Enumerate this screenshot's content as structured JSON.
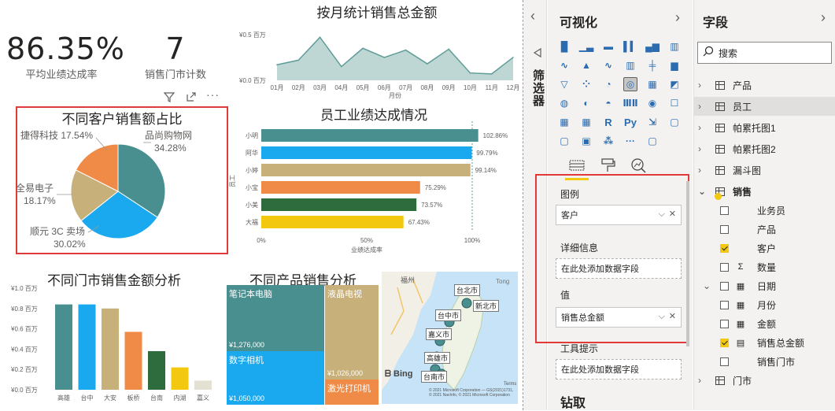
{
  "kpis": [
    {
      "value": "86.35%",
      "label": "平均业绩达成率"
    },
    {
      "value": "7",
      "label": "销售门市计数"
    }
  ],
  "charts": {
    "monthly": {
      "title": "按月统计销售总金额",
      "xlabel": "月份"
    },
    "pie": {
      "title": "不同客户销售额占比"
    },
    "staff": {
      "title": "员工业绩达成情况",
      "ylabel": "员工",
      "xlabel": "业绩达成率"
    },
    "store": {
      "title": "不同门市销售金额分析"
    },
    "product": {
      "title": "不同产品销售分析"
    }
  },
  "chart_data": [
    {
      "type": "area",
      "title": "按月统计销售总金额",
      "xlabel": "月份",
      "categories": [
        "01月",
        "02月",
        "03月",
        "04月",
        "05月",
        "06月",
        "07月",
        "08月",
        "09月",
        "10月",
        "11月",
        "12月"
      ],
      "values": [
        0.17,
        0.22,
        0.47,
        0.15,
        0.35,
        0.25,
        0.33,
        0.18,
        0.34,
        0.08,
        0.07,
        0.25
      ],
      "yticks": [
        "¥0.0 百万",
        "¥0.5 百万"
      ],
      "ylim": [
        0,
        0.55
      ],
      "color": "#a8c8c5"
    },
    {
      "type": "pie",
      "title": "不同客户销售额占比",
      "slices": [
        {
          "label": "品尚购物网",
          "pct": "34.28%",
          "value": 34.28,
          "color": "#4a8f8f"
        },
        {
          "label": "顺元 3C 卖场",
          "pct": "30.02%",
          "value": 30.02,
          "color": "#1aa9ef"
        },
        {
          "label": "全易电子",
          "pct": "18.17%",
          "value": 18.17,
          "color": "#c8b07a"
        },
        {
          "label": "捷得科技",
          "pct": "17.54%",
          "value": 17.54,
          "color": "#ef8b47"
        }
      ]
    },
    {
      "type": "bar",
      "orientation": "horizontal",
      "title": "员工业绩达成情况",
      "ylabel": "员工",
      "xlabel": "业绩达成率",
      "categories": [
        "小明",
        "阿华",
        "小婷",
        "小宝",
        "小美",
        "大福"
      ],
      "values": [
        102.86,
        99.79,
        99.14,
        75.29,
        73.57,
        67.43
      ],
      "labels": [
        "102.86%",
        "99.79%",
        "99.14%",
        "75.29%",
        "73.57%",
        "67.43%"
      ],
      "colors": [
        "#4a8f8f",
        "#1aa9ef",
        "#c8b07a",
        "#ef8b47",
        "#2e6b3d",
        "#f2c811"
      ],
      "xticks": [
        "0%",
        "50%",
        "100%"
      ],
      "xlim": [
        0,
        100
      ]
    },
    {
      "type": "bar",
      "title": "不同门市销售金额分析",
      "categories": [
        "高雄",
        "台中",
        "大安",
        "板桥",
        "台南",
        "内湖",
        "嘉义"
      ],
      "values": [
        0.84,
        0.84,
        0.8,
        0.57,
        0.38,
        0.22,
        0.09
      ],
      "colors": [
        "#4a8f8f",
        "#1aa9ef",
        "#c8b07a",
        "#ef8b47",
        "#2e6b3d",
        "#f2c811",
        "#e4e1d3"
      ],
      "yticks": [
        "¥0.0 百万",
        "¥0.2 百万",
        "¥0.4 百万",
        "¥0.6 百万",
        "¥0.8 百万",
        "¥1.0 百万"
      ],
      "ylim": [
        0,
        1.0
      ]
    },
    {
      "type": "treemap",
      "title": "不同产品销售分析",
      "items": [
        {
          "label": "笔记本电脑",
          "value": "¥1,276,000",
          "color": "#4a8f8f"
        },
        {
          "label": "数字相机",
          "value": "¥1,050,000",
          "color": "#1aa9ef"
        },
        {
          "label": "液晶电视",
          "value": "¥1,026,000",
          "color": "#c8b07a"
        },
        {
          "label": "激光打印机",
          "value": "",
          "color": "#ef8b47"
        }
      ]
    }
  ],
  "map": {
    "cities": [
      "福州",
      "台北市",
      "新北市",
      "台中市",
      "嘉义市",
      "高雄市",
      "台南市",
      "Tong"
    ],
    "brand": "Bing",
    "credit": "© 2021 Microsoft Corporation — GS(2021)1731, © 2021 NavInfo, © 2021 Microsoft Corporation",
    "terms": "Terms"
  },
  "visual_header": {
    "filter_icon": "filter-icon",
    "focus_icon": "focus-mode-icon",
    "more": "···"
  },
  "filters_pane": {
    "label": "筛选器",
    "collapse": "‹"
  },
  "viz_pane": {
    "title": "可视化",
    "expand_left": "‹",
    "expand_right": "›",
    "wells": [
      {
        "label": "图例",
        "value": "客户",
        "filled": true
      },
      {
        "label": "详细信息",
        "value": "在此处添加数据字段",
        "filled": false
      },
      {
        "label": "值",
        "value": "销售总金额",
        "filled": true
      },
      {
        "label": "工具提示",
        "value": "在此处添加数据字段",
        "filled": false
      }
    ],
    "drill": "钻取"
  },
  "fields_pane": {
    "title": "字段",
    "expand": "›",
    "search_placeholder": "搜索",
    "tables": [
      "产品",
      "员工",
      "帕累托图1",
      "帕累托图2",
      "漏斗图",
      "销售",
      "门市"
    ],
    "sales_fields": [
      {
        "name": "业务员",
        "checked": false,
        "type": ""
      },
      {
        "name": "产品",
        "checked": false,
        "type": ""
      },
      {
        "name": "客户",
        "checked": true,
        "type": ""
      },
      {
        "name": "数量",
        "checked": false,
        "type": "Σ"
      },
      {
        "name": "日期",
        "checked": false,
        "type": "date"
      },
      {
        "name": "月份",
        "checked": false,
        "type": "cal"
      },
      {
        "name": "金额",
        "checked": false,
        "type": "cal"
      },
      {
        "name": "销售总金额",
        "checked": true,
        "type": "calc"
      },
      {
        "name": "销售门市",
        "checked": false,
        "type": ""
      }
    ]
  }
}
